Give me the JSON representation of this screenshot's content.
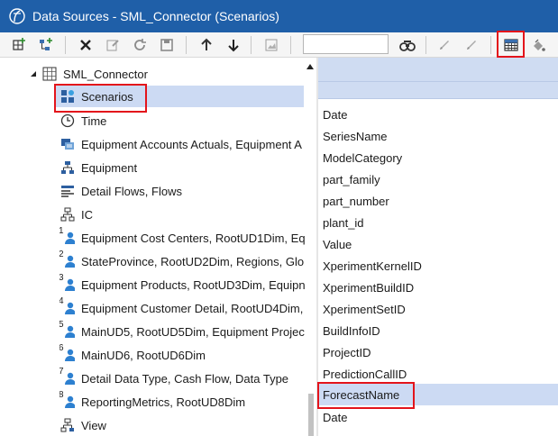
{
  "window": {
    "title": "Data Sources - SML_Connector  (Scenarios)"
  },
  "toolbar": {
    "search_value": "",
    "buttons": [
      "add-data-source-icon",
      "add-child-icon",
      "delete-icon",
      "edit-document-icon",
      "refresh-icon",
      "save-icon",
      "move-up-icon",
      "move-down-icon",
      "image-icon",
      "search-run-icon",
      "pencil-icon",
      "pencil-alt-icon",
      "grid-view-icon",
      "fill-icon"
    ]
  },
  "tree": {
    "root": {
      "label": "SML_Connector"
    },
    "items": [
      {
        "label": "Scenarios",
        "icon": "scenario-icon"
      },
      {
        "label": "Time",
        "icon": "clock-icon"
      },
      {
        "label": "Equipment Accounts Actuals, Equipment A",
        "icon": "accounts-icon"
      },
      {
        "label": "Equipment",
        "icon": "hierarchy-icon"
      },
      {
        "label": "Detail Flows, Flows",
        "icon": "flows-icon"
      },
      {
        "label": "IC",
        "icon": "ic-hierarchy-icon"
      },
      {
        "label": "Equipment Cost Centers, RootUD1Dim, Equ",
        "icon": "ud-icon",
        "num": "1"
      },
      {
        "label": "StateProvince, RootUD2Dim, Regions, Glob",
        "icon": "ud-icon",
        "num": "2"
      },
      {
        "label": "Equipment Products, RootUD3Dim, Equipn",
        "icon": "ud-icon",
        "num": "3"
      },
      {
        "label": "Equipment Customer Detail, RootUD4Dim,",
        "icon": "ud-icon",
        "num": "4"
      },
      {
        "label": "MainUD5, RootUD5Dim, Equipment Projec",
        "icon": "ud-icon",
        "num": "5"
      },
      {
        "label": "MainUD6, RootUD6Dim",
        "icon": "ud-icon",
        "num": "6"
      },
      {
        "label": "Detail Data Type, Cash Flow, Data Type",
        "icon": "ud-icon",
        "num": "7"
      },
      {
        "label": "ReportingMetrics, RootUD8Dim",
        "icon": "ud-icon",
        "num": "8"
      },
      {
        "label": "View",
        "icon": "view-icon"
      }
    ]
  },
  "fields": [
    "Date",
    "SeriesName",
    "ModelCategory",
    "part_family",
    "part_number",
    "plant_id",
    "Value",
    "XperimentKernelID",
    "XperimentBuildID",
    "XperimentSetID",
    "BuildInfoID",
    "ProjectID",
    "PredictionCallID",
    "ForecastName",
    "Date"
  ],
  "colors": {
    "titlebar": "#1f5fa8",
    "selection": "#ccdaf3",
    "highlight_box": "#e3141b"
  }
}
